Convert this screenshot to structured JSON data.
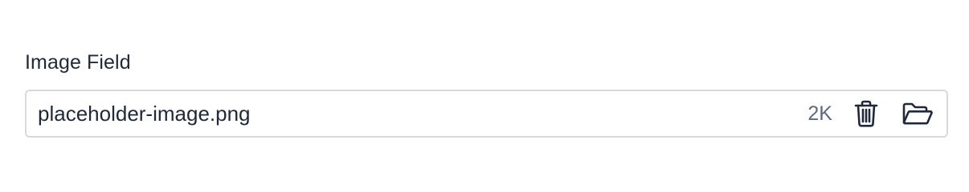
{
  "field": {
    "label": "Image Field",
    "file_name": "placeholder-image.png",
    "file_size": "2K"
  },
  "icons": {
    "delete": "trash-icon",
    "open": "folder-open-icon"
  },
  "colors": {
    "label_text": "#1f2937",
    "size_text": "#5e6b7c",
    "border": "#d7d9de",
    "icon": "#1f2937"
  }
}
